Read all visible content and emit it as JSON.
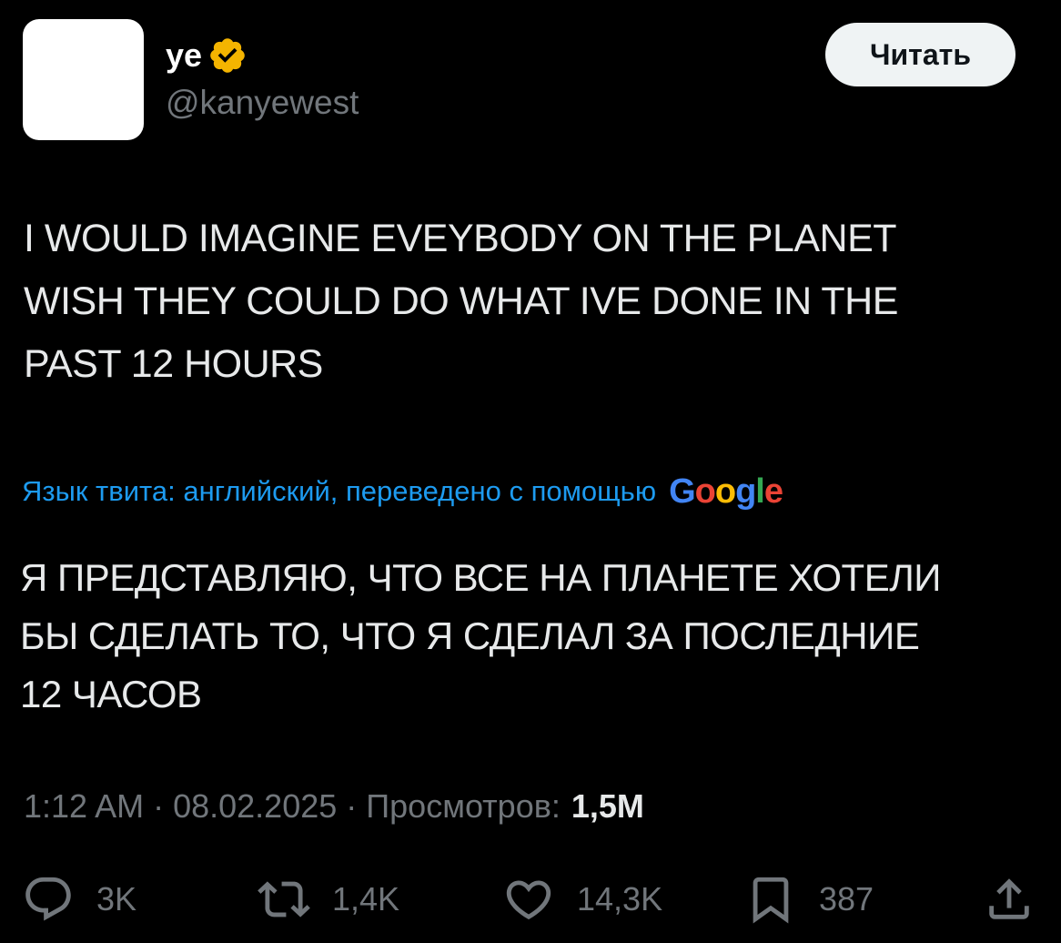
{
  "author": {
    "display_name": "ye",
    "handle": "@kanyewest",
    "verified_color": "#f4b400"
  },
  "header": {
    "read_label": "Читать"
  },
  "tweet": {
    "lines": [
      "I WOULD IMAGINE EVEYBODY ON THE PLANET",
      "WISH THEY COULD DO WHAT IVE DONE IN THE",
      "PAST 12 HOURS"
    ]
  },
  "translation": {
    "note": "Язык твита: английский, переведено с помощью",
    "provider": {
      "letters": [
        "G",
        "o",
        "o",
        "g",
        "l",
        "e"
      ]
    },
    "lines": [
      "Я ПРЕДСТАВЛЯЮ, ЧТО ВСЕ НА ПЛАНЕТЕ ХОТЕЛИ",
      "БЫ СДЕЛАТЬ ТО, ЧТО Я СДЕЛАЛ ЗА ПОСЛЕДНИЕ",
      "12 ЧАСОВ"
    ]
  },
  "meta": {
    "time": "1:12 AM",
    "separator": "·",
    "date": "08.02.2025",
    "views_label": "Просмотров:",
    "views_count": "1,5M"
  },
  "actions": {
    "replies": "3K",
    "retweets": "1,4K",
    "likes": "14,3K",
    "bookmarks": "387"
  },
  "colors": {
    "background": "#000000",
    "text": "#e7e9ea",
    "muted": "#71767b",
    "link": "#1d9bf0",
    "button_bg": "#eff3f4"
  }
}
